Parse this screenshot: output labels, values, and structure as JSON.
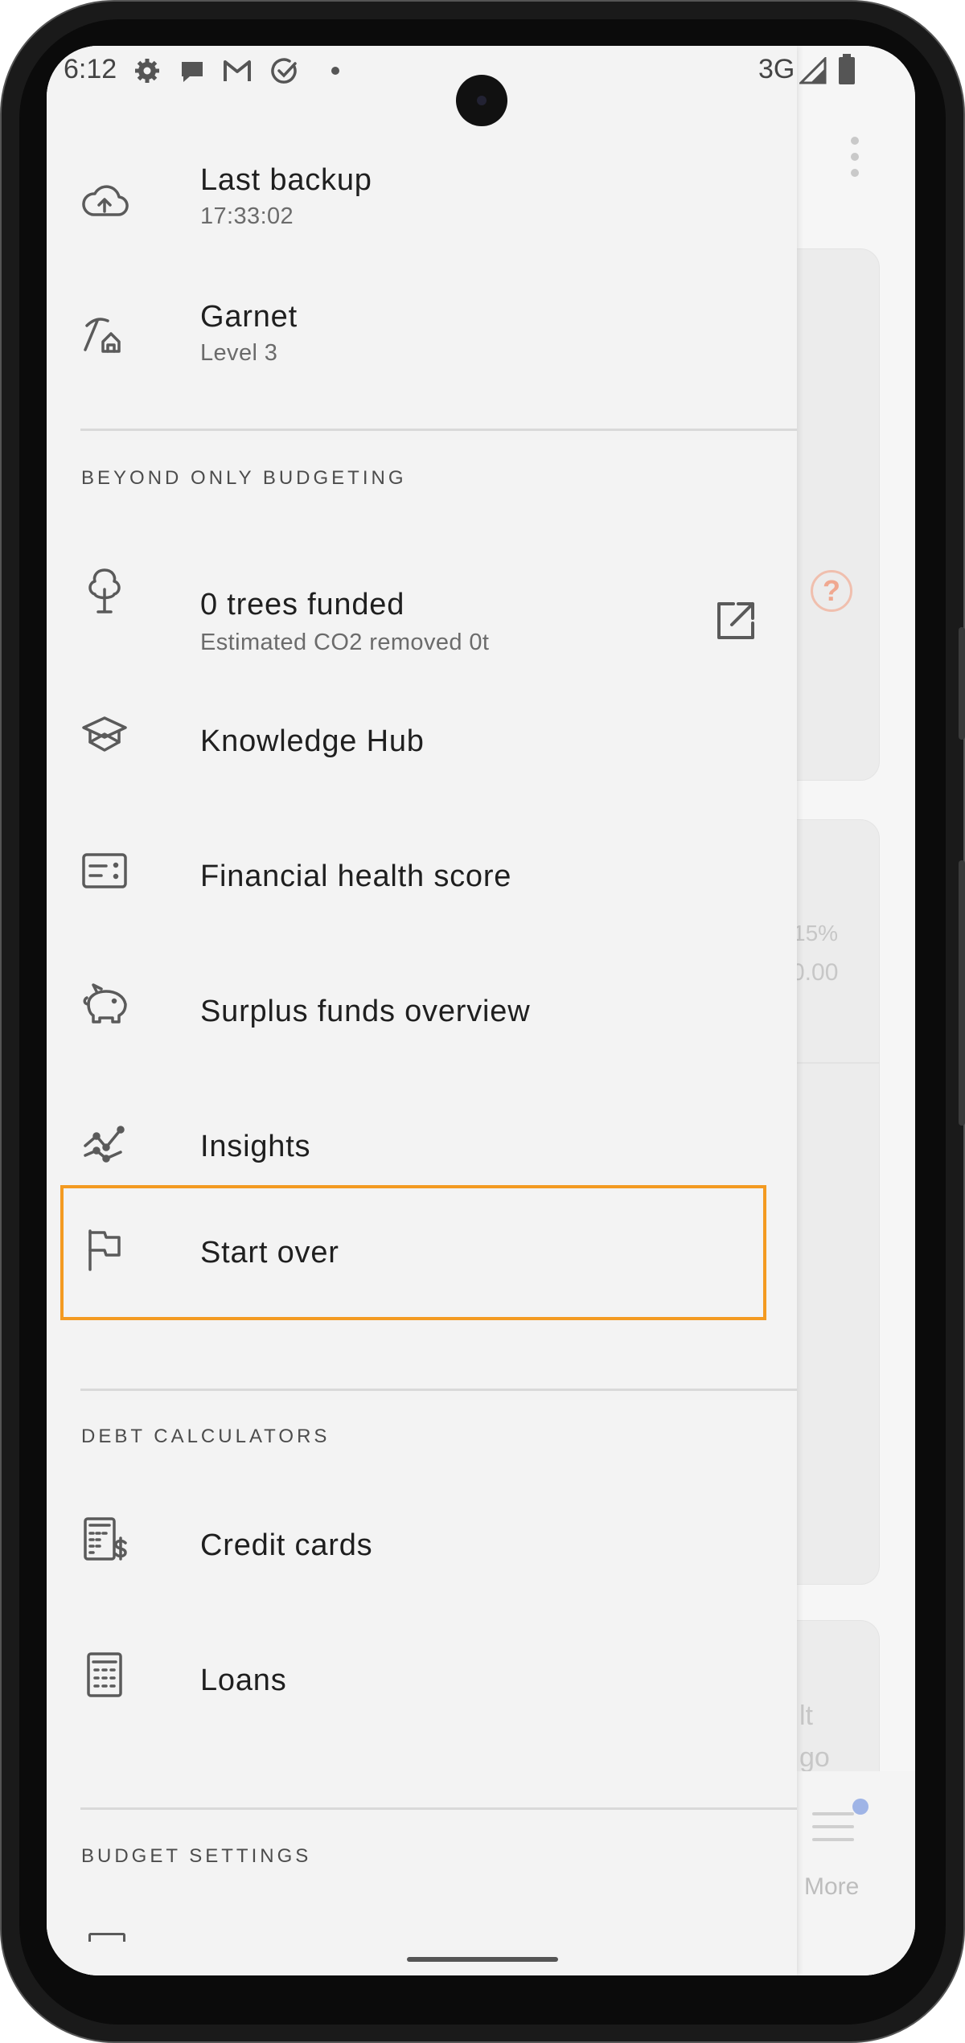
{
  "status_bar": {
    "time": "6:12",
    "network": "3G",
    "icons": [
      "settings-icon",
      "chat-icon",
      "gmail-icon",
      "check-circle-icon",
      "dot-icon",
      "signal-icon",
      "battery-icon"
    ]
  },
  "drawer": {
    "items": [
      {
        "icon": "cloud-upload-icon",
        "title": "Last backup",
        "subtitle": "17:33:02"
      },
      {
        "icon": "pickaxe-icon",
        "title": "Garnet",
        "subtitle": "Level 3"
      }
    ],
    "section_beyond": {
      "label": "BEYOND ONLY BUDGETING",
      "items": [
        {
          "icon": "tree-icon",
          "title": "0 trees funded",
          "subtitle": "Estimated CO2 removed 0t",
          "trailing_icon": "external-link-icon"
        },
        {
          "icon": "graduation-cap-icon",
          "title": "Knowledge Hub"
        },
        {
          "icon": "scorecard-icon",
          "title": "Financial health score"
        },
        {
          "icon": "piggy-bank-icon",
          "title": "Surplus funds overview"
        },
        {
          "icon": "insights-icon",
          "title": "Insights"
        },
        {
          "icon": "flag-icon",
          "title": "Start over",
          "highlighted": true,
          "highlight_color": "#f39a21"
        }
      ]
    },
    "section_debt": {
      "label": "DEBT CALCULATORS",
      "items": [
        {
          "icon": "calculator-dollar-icon",
          "title": "Credit cards"
        },
        {
          "icon": "calculator-icon",
          "title": "Loans"
        }
      ]
    },
    "section_settings": {
      "label": "BUDGET SETTINGS"
    }
  },
  "background_app": {
    "ghost_texts": [
      "15%",
      "0.00",
      "lt",
      "go"
    ],
    "bottom_nav_label": "More",
    "help_icon": "help-circle-icon",
    "menu_icon": "more-vert-icon"
  },
  "colors": {
    "drawer_bg": "#f3f3f3",
    "highlight": "#f39a21",
    "icon": "#5a5a5a",
    "text_primary": "#1f1f1f",
    "text_secondary": "#6b6b6b",
    "notification_dot": "#9fb4e6"
  }
}
